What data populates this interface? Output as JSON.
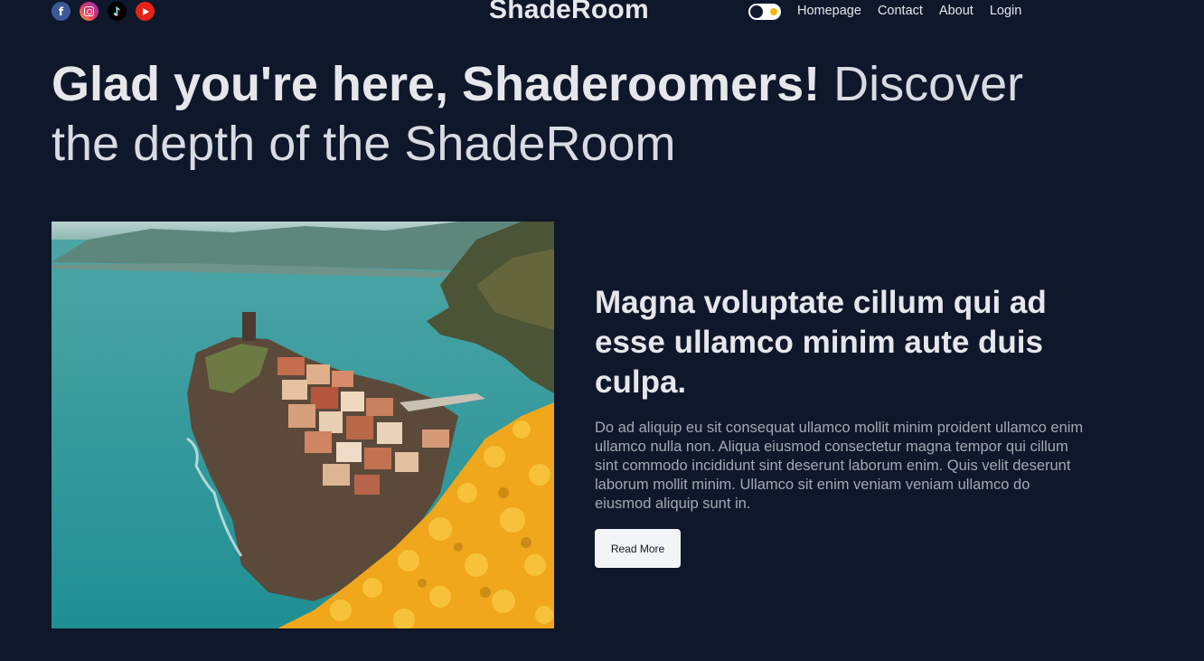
{
  "header": {
    "social": [
      {
        "name": "facebook",
        "icon": "facebook-icon",
        "glyph": "f",
        "color": "#3b5998"
      },
      {
        "name": "instagram",
        "icon": "instagram-icon",
        "color": "#e1306c"
      },
      {
        "name": "tiktok",
        "icon": "tiktok-icon",
        "glyph": "♪",
        "color": "#000000"
      },
      {
        "name": "youtube",
        "icon": "youtube-icon",
        "color": "#e62117"
      }
    ],
    "logo": "ShadeRoom",
    "theme_toggle": {
      "icon": "theme-toggle-icon",
      "accent": "#f5b50a"
    },
    "nav": [
      {
        "label": "Homepage"
      },
      {
        "label": "Contact"
      },
      {
        "label": "About"
      },
      {
        "label": "Login"
      }
    ]
  },
  "hero": {
    "bold": "Glad you're here, Shaderoomers!",
    "light": " Discover the depth of the ShadeRoom"
  },
  "featured_post": {
    "image": "coastal-village-photo",
    "title": "Magna voluptate cillum qui ad esse ullamco minim aute duis culpa.",
    "body": "Do ad aliquip eu sit consequat ullamco mollit minim proident ullamco enim ullamco nulla non. Aliqua eiusmod consectetur magna tempor qui cillum sint commodo incididunt sint deserunt laborum enim. Quis velit deserunt laborum mollit minim. Ullamco sit enim veniam veniam ullamco do eiusmod aliquip sunt in.",
    "button_label": "Read More"
  },
  "colors": {
    "background": "#0f172a",
    "text": "#e5e7eb",
    "muted": "#a3a8b3",
    "button_bg": "#f3f4f6"
  }
}
